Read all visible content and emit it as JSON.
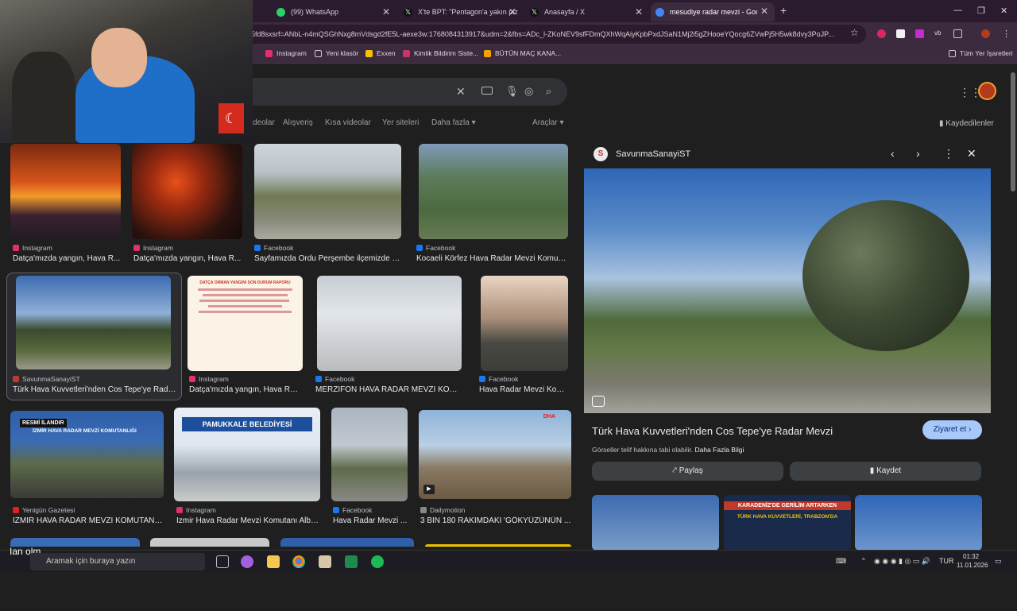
{
  "tabs": [
    {
      "label": "(99) WhatsApp",
      "color": "#25d366"
    },
    {
      "label": "X'te BPT: \"Pentagon'a yakın piz",
      "color": "#111111"
    },
    {
      "label": "Anasayfa / X",
      "color": "#111111"
    },
    {
      "label": "mesudiye radar mevzi - Google",
      "color": "#4285f4"
    }
  ],
  "url": "5fd8sxsrf=ANbL-n4mQSGhNxg8mVdsgd2fE5L-aexe3w:1768084313917&udm=2&fbs=ADc_l-ZKoNEV9sfFDmQXhWqAiyKpbPxdJSaN1Mj2i5gZHooeYQocg6ZVwPj5H5wk8dvy3PoJP...",
  "bookmarks": [
    {
      "label": "Instagram",
      "color": "#e1306c"
    },
    {
      "label": "Yeni klasör",
      "color": "#888888"
    },
    {
      "label": "Exxen",
      "color": "#f5c400"
    },
    {
      "label": "Kimlik Bildirim Siste...",
      "color": "#cc3366"
    },
    {
      "label": "BÜTÜN MAÇ KANA...",
      "color": "#f5a300"
    }
  ],
  "all_bookmarks": "Tüm Yer İşaretleri",
  "filters": [
    "deolar",
    "Alışveriş",
    "Kısa videolar",
    "Yer siteleri",
    "Daha fazla ▾",
    "Araçlar ▾"
  ],
  "saved": "Kaydedilenler",
  "results": [
    {
      "source": "Instagram",
      "caption": "Datça'mızda yangın, Hava R...",
      "src_color": "#e1306c"
    },
    {
      "source": "Instagram",
      "caption": "Datça'mızda yangın, Hava R...",
      "src_color": "#e1306c"
    },
    {
      "source": "Facebook",
      "caption": "Sayfamızda Ordu Perşembe ilçemizde g...",
      "src_color": "#1877f2"
    },
    {
      "source": "Facebook",
      "caption": "Kocaeli Körfez Hava Radar Mevzi Komuta...",
      "src_color": "#1877f2"
    },
    {
      "source": "SavunmaSanayiST",
      "caption": "Türk Hava Kuvvetleri'nden Cos Tepe'ye Rada...",
      "src_color": "#c0392b"
    },
    {
      "source": "Instagram",
      "caption": "Datça'mızda yangın, Hava Ra...",
      "src_color": "#e1306c"
    },
    {
      "source": "Facebook",
      "caption": "MERZİFON HAVA RADAR MEVZİ KOMU...",
      "src_color": "#1877f2"
    },
    {
      "source": "Facebook",
      "caption": "Hava Radar Mevzi Kom...",
      "src_color": "#1877f2"
    },
    {
      "source": "Yenigün Gazetesi",
      "caption": "İZMİR HAVA RADAR MEVZİ KOMUTANL...",
      "src_color": "#e02020"
    },
    {
      "source": "Instagram",
      "caption": "İzmir Hava Radar Mevzi Komutanı Alba...",
      "src_color": "#e1306c"
    },
    {
      "source": "Facebook",
      "caption": "Hava Radar Mevzi ...",
      "src_color": "#1877f2"
    },
    {
      "source": "Dailymotion",
      "caption": "3 BİN 180 RAKIMDAKİ 'GÖKYÜZÜNÜN ...",
      "src_color": "#888888"
    }
  ],
  "thumb_text": {
    "datca_title": "DATÇA ORMAN YANGINI SON DURUM RAPORU",
    "resmi": "RESMİ İLANDIR",
    "izmir_sign": "İZMİR HAVA RADAR MEVZİ KOMUTANLIĞI",
    "pamukkale": "PAMUKKALE BELEDİYESİ",
    "dha": "DHA",
    "karadeniz1": "KARADENİZ'DE GERİLİM ARTARKEN",
    "karadeniz2": "TÜRK HAVA KUVVETLERİ, TRABZON'DA"
  },
  "panel": {
    "site": "SavunmaSanayiST",
    "title": "Türk Hava Kuvvetleri'nden Cos Tepe'ye Radar Mevzi",
    "visit": "Ziyaret et ›",
    "copyright": "Görseller telif hakkına tabi olabilir.",
    "more_info": "Daha Fazla Bilgi",
    "share": "Paylaş",
    "save": "Kaydet"
  },
  "taskbar": {
    "search": "Aramak için buraya yazın",
    "lang": "TUR",
    "time": "01:32",
    "date": "11.01.2026",
    "overlay": "Ian olm"
  }
}
